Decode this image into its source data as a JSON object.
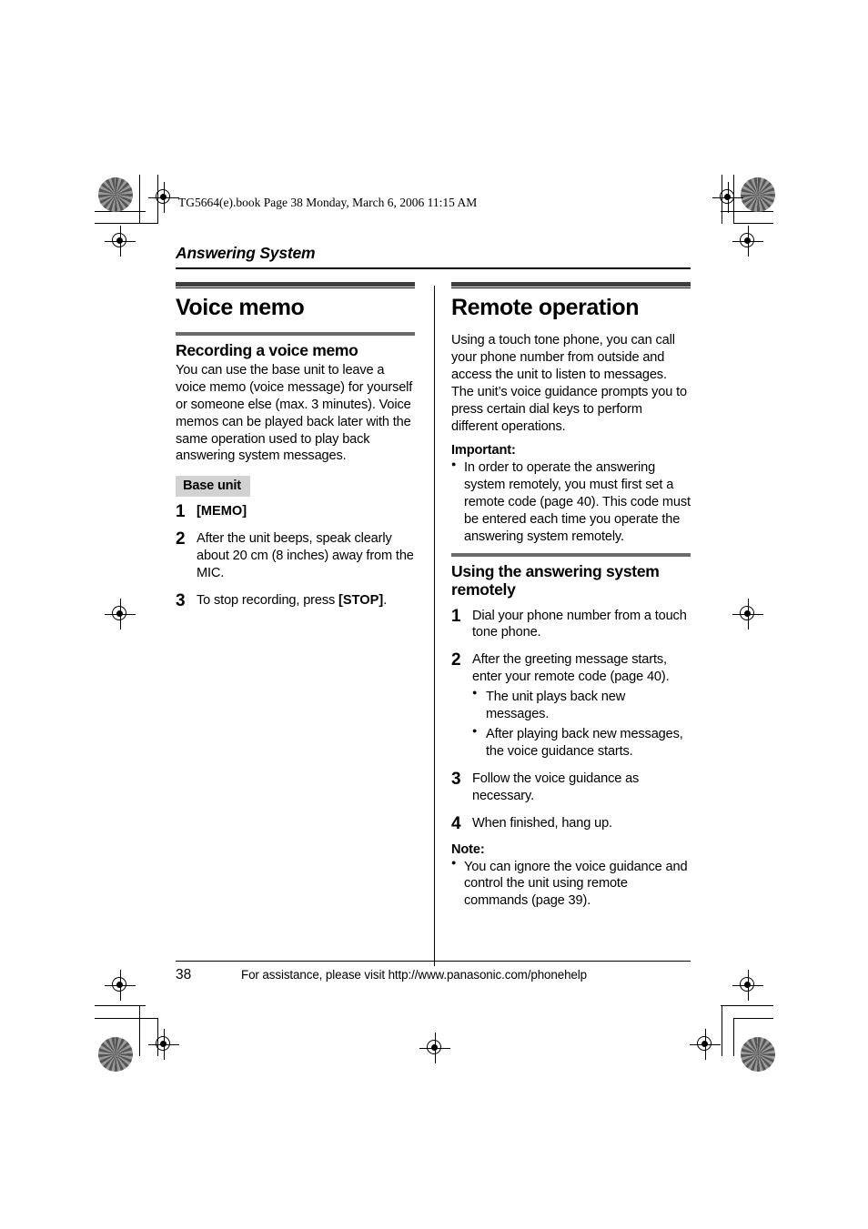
{
  "file_stamp": "TG5664(e).book  Page 38  Monday, March 6, 2006  11:15 AM",
  "running_head": "Answering System",
  "left_column": {
    "section_title": "Voice memo",
    "sub_title": "Recording a voice memo",
    "intro": "You can use the base unit to leave a voice memo (voice message) for yourself or someone else (max. 3 minutes). Voice memos can be played back later with the same operation used to play back answering system messages.",
    "device_tag": "Base unit",
    "steps": [
      {
        "num": "1",
        "key_prefix": "[MEMO]",
        "text": ""
      },
      {
        "num": "2",
        "key_prefix": "",
        "text": "After the unit beeps, speak clearly about 20 cm (8 inches) away from the MIC."
      },
      {
        "num": "3",
        "key_prefix": "",
        "text": "To stop recording, press ",
        "key_suffix": "[STOP]",
        "text_after": "."
      }
    ]
  },
  "right_column": {
    "section_title": "Remote operation",
    "intro": "Using a touch tone phone, you can call your phone number from outside and access the unit to listen to messages. The unit’s voice guidance prompts you to press certain dial keys to perform different operations.",
    "important_label": "Important:",
    "important_bullets": [
      "In order to operate the answering system remotely, you must first set a remote code (page 40). This code must be entered each time you operate the answering system remotely."
    ],
    "sub_title": "Using the answering system remotely",
    "steps": [
      {
        "num": "1",
        "text": "Dial your phone number from a touch tone phone.",
        "sub_bullets": []
      },
      {
        "num": "2",
        "text": "After the greeting message starts, enter your remote code (page 40).",
        "sub_bullets": [
          "The unit plays back new messages.",
          "After playing back new messages, the voice guidance starts."
        ]
      },
      {
        "num": "3",
        "text": "Follow the voice guidance as necessary.",
        "sub_bullets": []
      },
      {
        "num": "4",
        "text": "When finished, hang up.",
        "sub_bullets": []
      }
    ],
    "note_label": "Note:",
    "note_bullets": [
      "You can ignore the voice guidance and control the unit using remote commands (page 39)."
    ]
  },
  "footer": {
    "page_number": "38",
    "assistance_text": "For assistance, please visit http://www.panasonic.com/phonehelp"
  },
  "colors": {
    "rule_thick": "#3f3f3f",
    "rule_sub": "#6b6b6b",
    "tag_background": "#d2d2d2",
    "text": "#000000"
  }
}
